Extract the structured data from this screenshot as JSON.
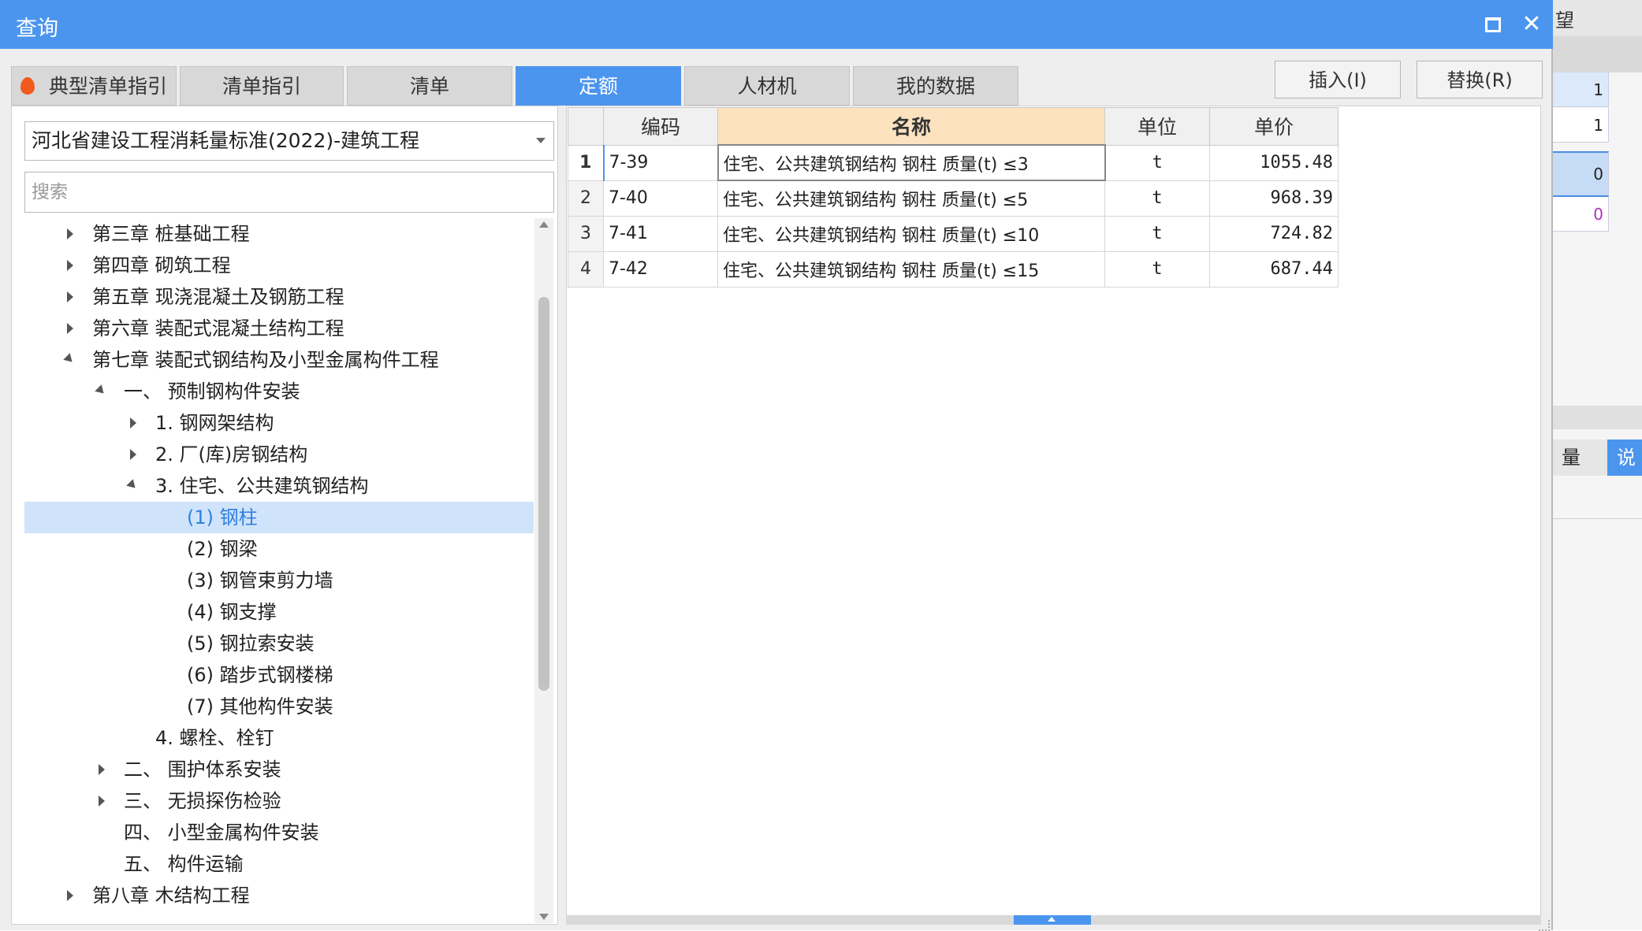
{
  "dialog": {
    "title": "查询"
  },
  "tabs": [
    {
      "label": "典型清单指引",
      "active": false
    },
    {
      "label": "清单指引",
      "active": false
    },
    {
      "label": "清单",
      "active": false
    },
    {
      "label": "定额",
      "active": true
    },
    {
      "label": "人材机",
      "active": false
    },
    {
      "label": "我的数据",
      "active": false
    }
  ],
  "actions": {
    "insert": "插入(I)",
    "replace": "替换(R)"
  },
  "left": {
    "standard_selected": "河北省建设工程消耗量标准(2022)-建筑工程",
    "search_placeholder": "搜索",
    "tree": [
      {
        "label": "第三章 桩基础工程",
        "level": 0,
        "expander": "closed"
      },
      {
        "label": "第四章 砌筑工程",
        "level": 0,
        "expander": "closed"
      },
      {
        "label": "第五章 现浇混凝土及钢筋工程",
        "level": 0,
        "expander": "closed"
      },
      {
        "label": "第六章 装配式混凝土结构工程",
        "level": 0,
        "expander": "closed"
      },
      {
        "label": "第七章 装配式钢结构及小型金属构件工程",
        "level": 0,
        "expander": "open"
      },
      {
        "label": "一、 预制钢构件安装",
        "level": 1,
        "expander": "open"
      },
      {
        "label": "1. 钢网架结构",
        "level": 2,
        "expander": "closed"
      },
      {
        "label": "2. 厂(库)房钢结构",
        "level": 2,
        "expander": "closed"
      },
      {
        "label": "3. 住宅、公共建筑钢结构",
        "level": 2,
        "expander": "open"
      },
      {
        "label": "(1) 钢柱",
        "level": 3,
        "expander": "none",
        "selected": true
      },
      {
        "label": "(2) 钢梁",
        "level": 3,
        "expander": "none"
      },
      {
        "label": "(3) 钢管束剪力墙",
        "level": 3,
        "expander": "none"
      },
      {
        "label": "(4) 钢支撑",
        "level": 3,
        "expander": "none"
      },
      {
        "label": "(5) 钢拉索安装",
        "level": 3,
        "expander": "none"
      },
      {
        "label": "(6) 踏步式钢楼梯",
        "level": 3,
        "expander": "none"
      },
      {
        "label": "(7) 其他构件安装",
        "level": 3,
        "expander": "none"
      },
      {
        "label": "4. 螺栓、栓钉",
        "level": 2,
        "expander": "none"
      },
      {
        "label": "二、 围护体系安装",
        "level": 1,
        "expander": "closed"
      },
      {
        "label": "三、 无损探伤检验",
        "level": 1,
        "expander": "closed"
      },
      {
        "label": "四、 小型金属构件安装",
        "level": 1,
        "expander": "none"
      },
      {
        "label": "五、 构件运输",
        "level": 1,
        "expander": "none"
      },
      {
        "label": "第八章 木结构工程",
        "level": 0,
        "expander": "closed"
      }
    ]
  },
  "grid": {
    "columns": [
      "编码",
      "名称",
      "单位",
      "单价"
    ],
    "rows": [
      {
        "no": "1",
        "code": "7-39",
        "name": "住宅、公共建筑钢结构 钢柱 质量(t) ≤3",
        "unit": "t",
        "price": "1055.48"
      },
      {
        "no": "2",
        "code": "7-40",
        "name": "住宅、公共建筑钢结构 钢柱 质量(t) ≤5",
        "unit": "t",
        "price": "968.39"
      },
      {
        "no": "3",
        "code": "7-41",
        "name": "住宅、公共建筑钢结构 钢柱 质量(t) ≤10",
        "unit": "t",
        "price": "724.82"
      },
      {
        "no": "4",
        "code": "7-42",
        "name": "住宅、公共建筑钢结构 钢柱 质量(t) ≤15",
        "unit": "t",
        "price": "687.44"
      }
    ]
  },
  "background_app": {
    "header_fragment": "望",
    "values": [
      "1",
      "1",
      "0",
      "0"
    ],
    "tab_fragments": [
      "量",
      "说"
    ]
  }
}
